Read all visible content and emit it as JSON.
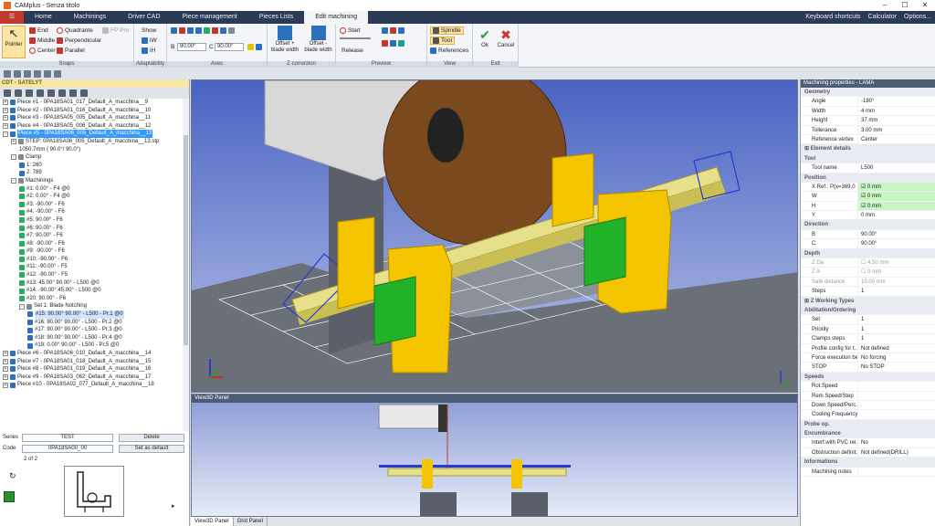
{
  "app": {
    "title": "CAMplus - Senza titolo",
    "window_controls": [
      "–",
      "☐",
      "✕"
    ]
  },
  "menu": {
    "tabs": [
      "Home",
      "Machinings",
      "Driver CAD",
      "Piece management",
      "Pieces Lists",
      "Edit machining"
    ],
    "active_tab": "Edit machining",
    "right_links": [
      "Keyboard shortcuts",
      "Calculator",
      "Options..."
    ]
  },
  "ribbon": {
    "snaps": {
      "label": "Snaps",
      "pointer": "Pointer",
      "end": "End",
      "middle": "Middle",
      "center": "Center",
      "quadrante": "Quadrante",
      "perpendicular": "Perpendicular",
      "parallel": "Parallel",
      "fp_pro": "FP Pro"
    },
    "adaptability": {
      "label": "Adaptability",
      "show": "Show",
      "iw": "iW",
      "ih": "iH"
    },
    "axes": {
      "label": "Axes",
      "b_label": "B",
      "b_value": "90.00°",
      "c_label": "C",
      "c_value": "90.00°"
    },
    "z_correction": {
      "label": "Z correction",
      "offset_plus": "Offset + blade width",
      "offset_minus": "Offset - blade width"
    },
    "preview": {
      "label": "Preview",
      "start": "Start",
      "release": "Release"
    },
    "view": {
      "label": "View",
      "spindle": "Spindle",
      "tool": "Tool",
      "references": "References"
    },
    "exit": {
      "label": "Exit",
      "ok": "Ok",
      "cancel": "Cancel"
    }
  },
  "left_panel": {
    "header": "CDT - SATELYT",
    "tree": [
      {
        "indent": 0,
        "text": "Piece #1 - 0PA18SA01_017_Default_A_macchina__9",
        "icon": "piece-icon",
        "toggle": "+"
      },
      {
        "indent": 0,
        "text": "Piece #2 - 0PA18SA01_016_Default_A_macchina__10",
        "icon": "piece-icon",
        "toggle": "+"
      },
      {
        "indent": 0,
        "text": "Piece #3 - 0PA18SA05_005_Default_A_macchina__11",
        "icon": "piece-icon",
        "toggle": "+"
      },
      {
        "indent": 0,
        "text": "Piece #4 - 0PA18SA05_006_Default_A_macchina__12",
        "icon": "piece-icon",
        "toggle": "+"
      },
      {
        "indent": 0,
        "text": "Piece #5 - 0PA18SA06_005_Default_A_macchina__13",
        "icon": "piece-icon",
        "toggle": "-",
        "state": "sel"
      },
      {
        "indent": 1,
        "text": "STEP: 0PA18SA06_005_Default_A_macchina__13.stp",
        "icon": "step-icon",
        "toggle": "+"
      },
      {
        "indent": 2,
        "text": "1050.7mm ( 90.0°/ 90.0°)",
        "icon": "",
        "toggle": ""
      },
      {
        "indent": 1,
        "text": "Clamp",
        "icon": "clamp-icon",
        "toggle": "-"
      },
      {
        "indent": 2,
        "text": "1: 280",
        "icon": "clamp-item-icon",
        "toggle": ""
      },
      {
        "indent": 2,
        "text": "2: 789",
        "icon": "clamp-item-icon",
        "toggle": ""
      },
      {
        "indent": 1,
        "text": "Machinings",
        "icon": "machinings-icon",
        "toggle": "-"
      },
      {
        "indent": 2,
        "text": "#1: 0.00° - F4 @0",
        "icon": "machining-icon",
        "toggle": ""
      },
      {
        "indent": 2,
        "text": "#2: 0.00° - F4 @0",
        "icon": "machining-icon",
        "toggle": ""
      },
      {
        "indent": 2,
        "text": "#3: -90.00° - F6",
        "icon": "machining-icon",
        "toggle": ""
      },
      {
        "indent": 2,
        "text": "#4: -90.00° - F6",
        "icon": "machining-icon",
        "toggle": ""
      },
      {
        "indent": 2,
        "text": "#5: 90.00° - F6",
        "icon": "machining-icon",
        "toggle": ""
      },
      {
        "indent": 2,
        "text": "#6: 90.00° - F6",
        "icon": "machining-icon",
        "toggle": ""
      },
      {
        "indent": 2,
        "text": "#7: 90.00° - F6",
        "icon": "machining-icon",
        "toggle": ""
      },
      {
        "indent": 2,
        "text": "#8: -90.00° - F6",
        "icon": "machining-icon",
        "toggle": ""
      },
      {
        "indent": 2,
        "text": "#9: -90.00° - F6",
        "icon": "machining-icon",
        "toggle": ""
      },
      {
        "indent": 2,
        "text": "#10: -90.00° - F6",
        "icon": "machining-icon",
        "toggle": ""
      },
      {
        "indent": 2,
        "text": "#11: -90.00° - F5",
        "icon": "machining-icon",
        "toggle": ""
      },
      {
        "indent": 2,
        "text": "#12: -90.00° - F5",
        "icon": "machining-icon",
        "toggle": ""
      },
      {
        "indent": 2,
        "text": "#13: 45.00° 90.00° - L500 @0",
        "icon": "machining-icon",
        "toggle": ""
      },
      {
        "indent": 2,
        "text": "#14: -90.00° 45.00° - L500 @0",
        "icon": "machining-icon",
        "toggle": ""
      },
      {
        "indent": 2,
        "text": "#20: 90.00° - F6",
        "icon": "machining-icon",
        "toggle": ""
      },
      {
        "indent": 2,
        "text": "Set 1: Blade Notching",
        "icon": "set-icon",
        "toggle": "-"
      },
      {
        "indent": 3,
        "text": "#15: 90.00° 90.00° - L500 - Pr.1 @0",
        "icon": "blade-icon",
        "toggle": "",
        "state": "hl"
      },
      {
        "indent": 3,
        "text": "#16: 90.00° 90.00° - L500 - Pr.2 @0",
        "icon": "blade-icon",
        "toggle": ""
      },
      {
        "indent": 3,
        "text": "#17: 90.00° 90.00° - L500 - Pr.3 @0",
        "icon": "blade-icon",
        "toggle": ""
      },
      {
        "indent": 3,
        "text": "#18: 90.00° 90.00° - L500 - Pr.4 @0",
        "icon": "blade-icon",
        "toggle": ""
      },
      {
        "indent": 3,
        "text": "#19: 0.00° 90.00° - L500 - Pr.5 @0",
        "icon": "blade-icon",
        "toggle": ""
      },
      {
        "indent": 0,
        "text": "Piece #6 - 0PA18SA06_010_Default_A_macchina__14",
        "icon": "piece-icon",
        "toggle": "+"
      },
      {
        "indent": 0,
        "text": "Piece #7 - 0PA18SA01_018_Default_A_macchina__15",
        "icon": "piece-icon",
        "toggle": "+"
      },
      {
        "indent": 0,
        "text": "Piece #8 - 0PA18SA01_019_Default_A_macchina__16",
        "icon": "piece-icon",
        "toggle": "+"
      },
      {
        "indent": 0,
        "text": "Piece #9 - 0PA18SA03_062_Default_A_macchina__17",
        "icon": "piece-icon",
        "toggle": "+"
      },
      {
        "indent": 0,
        "text": "Piece #10 - 0PA18SA02_077_Default_A_macchina__18",
        "icon": "piece-icon",
        "toggle": "+"
      }
    ],
    "series_label": "Series",
    "series_value": "TEST",
    "delete_button": "Delete",
    "code_label": "Code",
    "code_value": "0PA18SA00_00",
    "set_default_button": "Set as default",
    "pager": "2  of  2"
  },
  "viewport": {
    "panel2_title": "View3D Panel",
    "bottom_tabs": [
      "View3D Panel",
      "Grid Panel"
    ]
  },
  "right_panel": {
    "title": "Machining properties - LAMA",
    "rows": [
      {
        "type": "cat",
        "k": "Geometry"
      },
      {
        "k": "Angle",
        "v": "-180°"
      },
      {
        "k": "Width",
        "v": "4 mm"
      },
      {
        "k": "Height",
        "v": "37 mm"
      },
      {
        "k": "Tollerance",
        "v": "3.00 mm"
      },
      {
        "k": "Reference vertex",
        "v": "Center"
      },
      {
        "type": "cat",
        "k": "⊞ Element details"
      },
      {
        "type": "cat",
        "k": "Tool"
      },
      {
        "k": "Tool name",
        "v": "L500"
      },
      {
        "type": "cat",
        "k": "Position"
      },
      {
        "k": "X   Ref.: P(x=369.0",
        "v": "☑ 0 mm",
        "style": "green"
      },
      {
        "k": "W",
        "v": "☑ 0 mm",
        "style": "green"
      },
      {
        "k": "H",
        "v": "☑ 0 mm",
        "style": "green"
      },
      {
        "k": "Y",
        "v": "0 mm"
      },
      {
        "type": "cat",
        "k": "Direction"
      },
      {
        "k": "B",
        "v": "90.00°"
      },
      {
        "k": "C",
        "v": "90.00°"
      },
      {
        "type": "cat",
        "k": "Depth"
      },
      {
        "k": "Z Da",
        "v": "☐ 4.50 mm",
        "style": "grey"
      },
      {
        "k": "Z A",
        "v": "☐ 0 mm",
        "style": "grey"
      },
      {
        "k": "Safe distance",
        "v": "10.00 mm",
        "style": "grey"
      },
      {
        "k": "Steps",
        "v": "1"
      },
      {
        "type": "cat",
        "k": "⊞ Z Working Types"
      },
      {
        "type": "cat",
        "k": "Abilitation/Ordering"
      },
      {
        "k": "Set",
        "v": "1"
      },
      {
        "k": "Priority",
        "v": "1"
      },
      {
        "k": "Clamps steps",
        "v": "1"
      },
      {
        "k": "Profile config for t...",
        "v": "Not defined"
      },
      {
        "k": "Force execution be...",
        "v": "No forcing"
      },
      {
        "k": "STOP",
        "v": "No STOP"
      },
      {
        "type": "cat",
        "k": "Speeds"
      },
      {
        "k": "Rot.Speed",
        "v": ""
      },
      {
        "k": "Rem.Speed/Step",
        "v": ""
      },
      {
        "k": "Down Speed/Perc...",
        "v": ""
      },
      {
        "k": "Cooling Frequency",
        "v": ""
      },
      {
        "type": "cat",
        "k": "Probe op."
      },
      {
        "type": "cat",
        "k": "Encumbrance"
      },
      {
        "k": "Interf.with PVC rei...",
        "v": "No"
      },
      {
        "k": "Obstruction definit.",
        "v": "Not defined(DRILL)"
      },
      {
        "type": "cat",
        "k": "Informations"
      },
      {
        "k": "Machining notes",
        "v": ""
      }
    ]
  },
  "colors": {
    "menubar": "#2b3a55",
    "selection": "#3399ff",
    "clamp_yellow": "#f5c400",
    "clamp_green": "#22b22a",
    "profile": "#e7e08a"
  }
}
